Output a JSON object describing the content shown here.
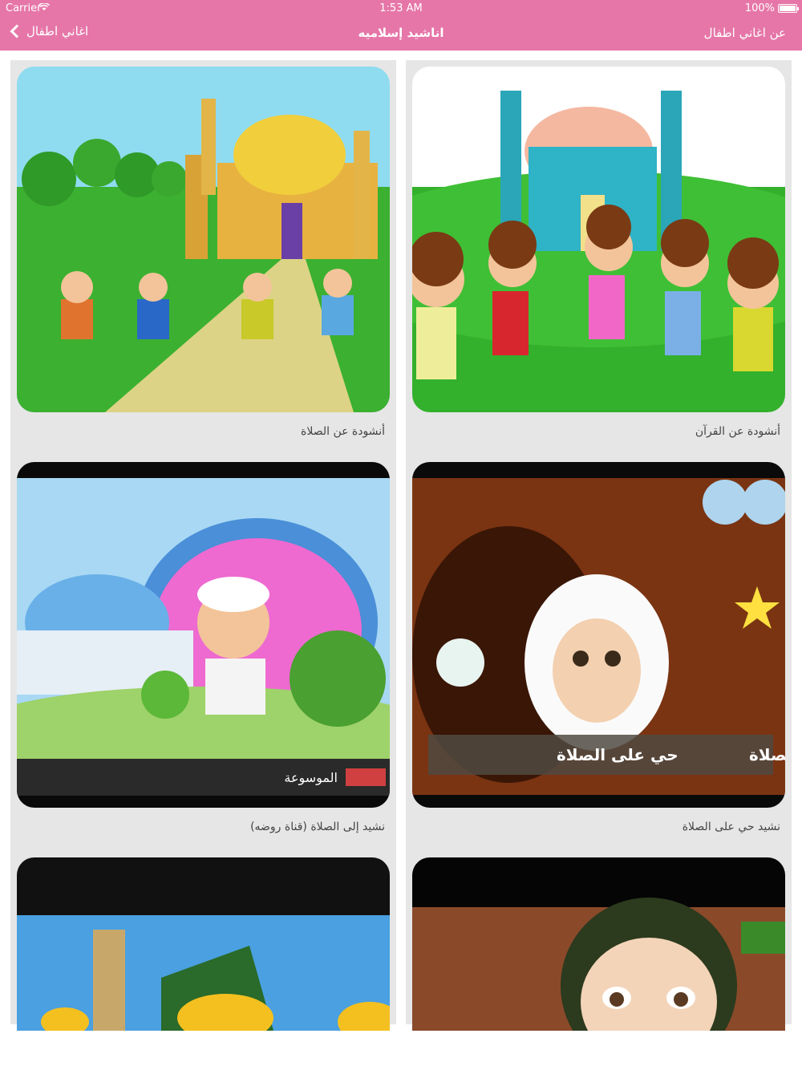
{
  "status_bar": {
    "carrier": "Carrier",
    "time": "1:53 AM",
    "battery": "100%"
  },
  "nav": {
    "back_label": "اغاني اطفال",
    "title": "اناشيد إسلاميه",
    "right_label": "عن اغاني اطفال"
  },
  "items": [
    {
      "title": "أنشودة عن الصلاة"
    },
    {
      "title": "أنشودة عن القرآن"
    },
    {
      "title": "نشيد إلى الصلاة (قناة روضه)"
    },
    {
      "title": "نشيد حي على الصلاة"
    }
  ],
  "thumbnail_text": {
    "channel_logo": "الموسوعة",
    "banner_left": "حي على الصلاة",
    "banner_right": "حي على الصلاة"
  },
  "colors": {
    "header": "#e676a8",
    "card_bg": "#e6e6e6"
  }
}
